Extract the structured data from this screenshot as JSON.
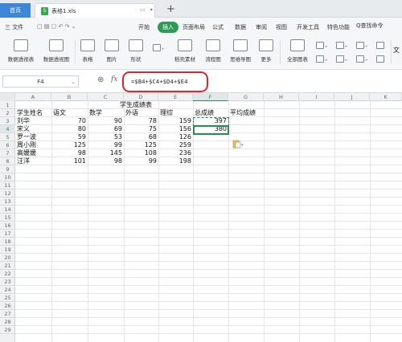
{
  "titlebar": {
    "home_tab": "首页",
    "file_tab": "表格1.xls",
    "file_icon": "S",
    "add_tab": "+"
  },
  "menu": {
    "items": [
      "三 文件",
      "开始",
      "页面布局",
      "公式",
      "数据",
      "审阅",
      "视图",
      "开发工具",
      "特色功能"
    ],
    "active": "插入",
    "search": "Q查找命令"
  },
  "ribbon": {
    "large": [
      "数据透视表",
      "数据透视图",
      "表格",
      "图片",
      "形状",
      "稻壳素材",
      "流程图",
      "思维导图",
      "更多",
      "全部图表"
    ],
    "more_glyph": "文"
  },
  "formula_bar": {
    "cell_ref": "F4",
    "fx": "fx",
    "formula": "=$B4+$C4+$D4+$E4"
  },
  "sheet": {
    "columns": [
      "A",
      "B",
      "C",
      "D",
      "E",
      "F",
      "G",
      "H",
      "I",
      "J",
      "K"
    ],
    "rows": [
      "1",
      "2",
      "3",
      "4",
      "5",
      "6",
      "7",
      "8",
      "9",
      "10",
      "11",
      "12",
      "13",
      "14",
      "15",
      "16",
      "17",
      "18",
      "19",
      "20",
      "21",
      "22",
      "23",
      "24",
      "25",
      "26",
      "27",
      "28",
      "29"
    ],
    "title": "学生成绩表",
    "headers": [
      "学生姓名",
      "语文",
      "数学",
      "外语",
      "理综",
      "总成绩",
      "平均成绩"
    ],
    "data": [
      [
        "刘华",
        "70",
        "90",
        "78",
        "159",
        "397"
      ],
      [
        "宋义",
        "80",
        "69",
        "75",
        "156",
        "380"
      ],
      [
        "罗一波",
        "59",
        "53",
        "68",
        "126",
        ""
      ],
      [
        "周小刚",
        "125",
        "99",
        "125",
        "259",
        ""
      ],
      [
        "高媛媛",
        "98",
        "145",
        "108",
        "236",
        ""
      ],
      [
        "汪洋",
        "101",
        "98",
        "99",
        "198",
        ""
      ]
    ]
  },
  "colors": {
    "accent": "#2e9b55",
    "highlight": "#e0242a",
    "home_tab": "#3e87d6"
  }
}
